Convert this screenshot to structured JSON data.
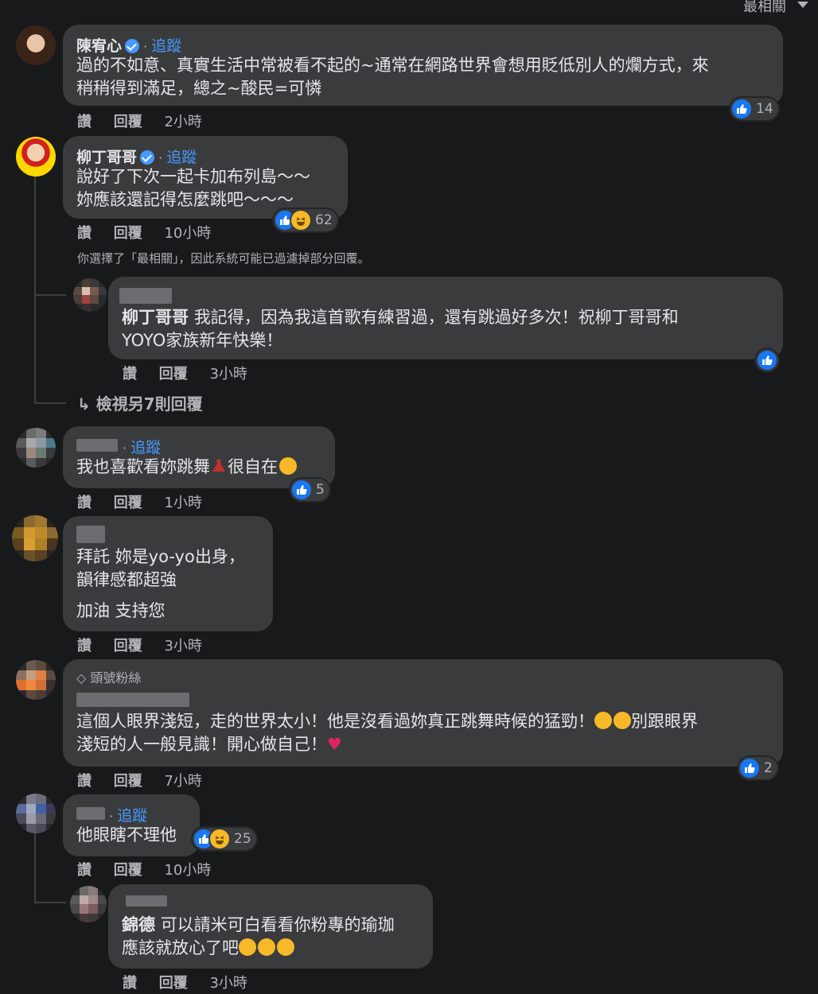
{
  "sort_label": "最相關",
  "follow_label": "追蹤",
  "dot": "·",
  "actions": {
    "like": "讚",
    "reply": "回覆"
  },
  "filter_notice": "你選擇了「最相關」，因此系統可能已過濾掉部分回覆。",
  "view_more": "檢視另7則回覆",
  "comments": [
    {
      "author": "陳宥心",
      "verified": true,
      "text_lines": [
        "過的不如意、真實生活中常被看不起的~通常在網路世界會想用貶低別人的爛方式，來",
        "稍稍得到滿足，總之~酸民=可憐"
      ],
      "time": "2小時",
      "reaction_count": "14"
    },
    {
      "author": "柳丁哥哥",
      "verified": true,
      "text_lines": [
        "說好了下次一起卡加布列島～～",
        "妳應該還記得怎麼跳吧～～～"
      ],
      "time": "10小時",
      "reaction_count": "62",
      "reply": {
        "mention": "柳丁哥哥",
        "text_lines": [
          "我記得，因為我這首歌有練習過，還有跳過好多次！祝柳丁哥哥和",
          "YOYO家族新年快樂！"
        ],
        "time": "3小時"
      }
    },
    {
      "text_line": "我也喜歡看妳跳舞",
      "text_after": "很自在",
      "time": "1小時",
      "reaction_count": "5"
    },
    {
      "text_lines": [
        "拜託 妳是yo-yo出身，",
        "韻律感都超強"
      ],
      "text_extra": "加油 支持您",
      "time": "3小時"
    },
    {
      "badge": "頭號粉絲",
      "text_lines": [
        "這個人眼界淺短，走的世界太小！他是沒看過妳真正跳舞時候的猛勁！",
        "淺短的人一般見識！開心做自己！"
      ],
      "text_after": "別跟眼界",
      "time": "7小時",
      "reaction_count": "2"
    },
    {
      "text_line": "他眼瞎不理他",
      "time": "10小時",
      "reaction_count": "25",
      "reply": {
        "mention": "錦德",
        "text_lines": [
          "可以請米可白看看你粉專的瑜珈",
          "應該就放心了吧"
        ],
        "time": "3小時"
      }
    }
  ],
  "colors": {
    "background": "#18191a",
    "bubble": "#3a3b3c",
    "link": "#4599ff",
    "like": "#1877f2"
  },
  "icons": [
    "like-icon",
    "haha-icon",
    "verified-icon",
    "reply-arrow-icon",
    "diamond-icon",
    "heart-icon",
    "sunglasses-icon",
    "rofl-icon",
    "wink-icon",
    "dress-icon"
  ]
}
